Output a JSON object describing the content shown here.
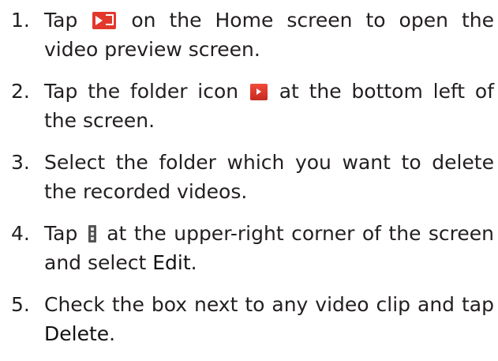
{
  "steps": [
    {
      "num": "1.",
      "text_a": "Tap ",
      "icon": "video-app-icon",
      "text_b": " on the Home screen to open the video preview screen."
    },
    {
      "num": "2.",
      "text_a": "Tap the folder icon ",
      "icon": "video-folder-icon",
      "text_b": " at the bottom left of the screen."
    },
    {
      "num": "3.",
      "text_a": "Select the folder which you want to delete the recorded videos."
    },
    {
      "num": "4.",
      "text_a": "Tap ",
      "icon": "menu-icon",
      "text_b": " at the upper-right corner of the screen and select ",
      "bold": "Edit",
      "text_c": "."
    },
    {
      "num": "5.",
      "text_a": "Check the box next to any video clip and tap ",
      "bold": "Delete",
      "text_c": "."
    }
  ],
  "colors": {
    "text": "#231f20",
    "icon_red": "#e2382c",
    "menu_gray": "#555555"
  }
}
